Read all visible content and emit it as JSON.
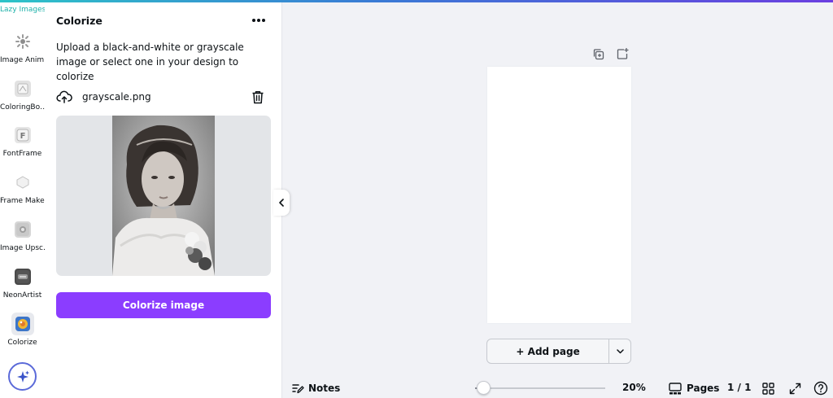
{
  "rail": {
    "cut_label": "Lazy Images",
    "items": [
      {
        "label": "Image Anim…",
        "icon": "sparkle-gear-icon"
      },
      {
        "label": "ColoringBo…",
        "icon": "coloring-book-icon"
      },
      {
        "label": "FontFrame",
        "icon": "font-frame-icon"
      },
      {
        "label": "Frame Maker",
        "icon": "frame-maker-icon"
      },
      {
        "label": "Image Upsc…",
        "icon": "image-upscaler-icon"
      },
      {
        "label": "NeonArtist",
        "icon": "neon-artist-icon"
      },
      {
        "label": "Colorize",
        "icon": "colorize-icon",
        "active": true
      }
    ],
    "magic_icon": "magic-sparkle-icon"
  },
  "panel": {
    "title": "Colorize",
    "description": "Upload a black-and-white or grayscale image or select one in your design to colorize",
    "file_name": "grayscale.png",
    "button_label": "Colorize image"
  },
  "canvas": {
    "add_page_label": "+ Add page"
  },
  "bottom_bar": {
    "notes_label": "Notes",
    "zoom_percent": 20,
    "zoom_label": "20%",
    "pages_label": "Pages",
    "page_count": "1 / 1"
  },
  "colors": {
    "accent": "#8b3dff",
    "canvas_bg": "#f1f2f6",
    "page_bg": "#ffffff"
  }
}
